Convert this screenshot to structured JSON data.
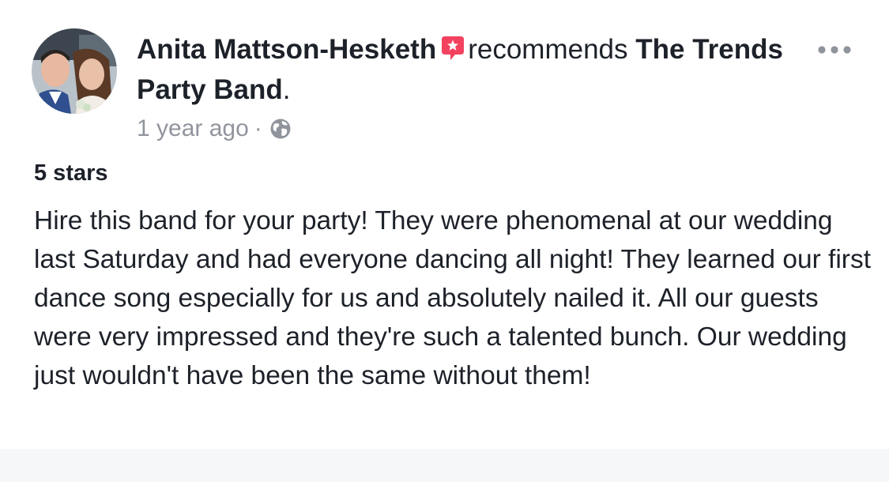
{
  "post": {
    "author": "Anita Mattson-Hesketh",
    "verb": "recommends",
    "page_name": "The Trends Party Band",
    "page_name_suffix": ".",
    "timestamp": "1 year ago",
    "separator": "·",
    "privacy_icon": "globe-icon",
    "recommend_icon": "recommendation-star-icon",
    "more_icon": "more-options-icon",
    "rating_label": "5 stars",
    "review_text": "Hire this band for your party! They were phenomenal at our wedding last Saturday and had everyone dancing all night! They learned our first dance song especially for us and absolutely nailed it. All our guests were very impressed and they're such a talented bunch. Our wedding just wouldn't have been the same without them!"
  },
  "colors": {
    "text_primary": "#1d2129",
    "text_secondary": "#90949c",
    "recommend_icon": "#f3425f",
    "background": "#ffffff"
  }
}
